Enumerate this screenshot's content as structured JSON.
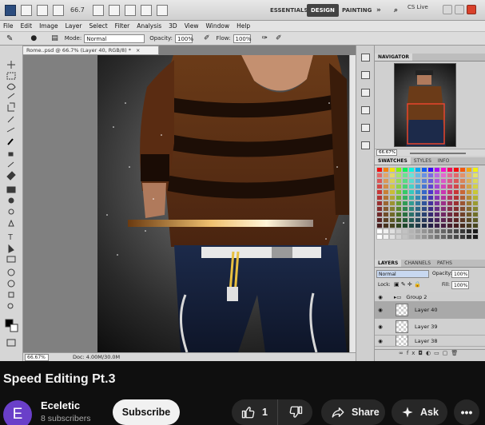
{
  "photoshop": {
    "zoom_level": "66.7",
    "workspaces": [
      "ESSENTIALS",
      "DESIGN",
      "PAINTING"
    ],
    "active_workspace": "DESIGN",
    "cs_live": "CS Live",
    "menu": [
      "File",
      "Edit",
      "Image",
      "Layer",
      "Select",
      "Filter",
      "Analysis",
      "3D",
      "View",
      "Window",
      "Help"
    ],
    "options": {
      "mode_label": "Mode:",
      "mode_value": "Normal",
      "opacity_label": "Opacity:",
      "opacity_value": "100%",
      "flow_label": "Flow:",
      "flow_value": "100%"
    },
    "document": {
      "tab_title": "Rome..psd @ 66.7% (Layer 40, RGB/8) *",
      "status_zoom": "66.67%",
      "status_doc": "Doc: 4.00M/30.0M"
    },
    "navigator": {
      "tab": "NAVIGATOR",
      "zoom": "66.67%"
    },
    "swatches_panel": {
      "tabs": [
        "SWATCHES",
        "STYLES",
        "INFO"
      ]
    },
    "layers_panel": {
      "tabs": [
        "LAYERS",
        "CHANNELS",
        "PATHS"
      ],
      "blend_mode": "Normal",
      "opacity_label": "Opacity:",
      "opacity_value": "100%",
      "lock_label": "Lock:",
      "fill_label": "Fill:",
      "fill_value": "100%",
      "layers": [
        "Group 2",
        "Layer 40",
        "Layer 39",
        "Layer 38"
      ]
    },
    "colors": {
      "accent_red": "#e8442c",
      "active_workspace_bg": "#444444"
    }
  },
  "video": {
    "title": "Speed Editing Pt.3",
    "channel": {
      "avatar_letter": "E",
      "name": "Eceletic",
      "subscribers": "8 subscribers",
      "avatar_color": "#6a3fc9"
    },
    "actions": {
      "subscribe": "Subscribe",
      "like_count": "1",
      "share": "Share",
      "ask": "Ask"
    }
  }
}
